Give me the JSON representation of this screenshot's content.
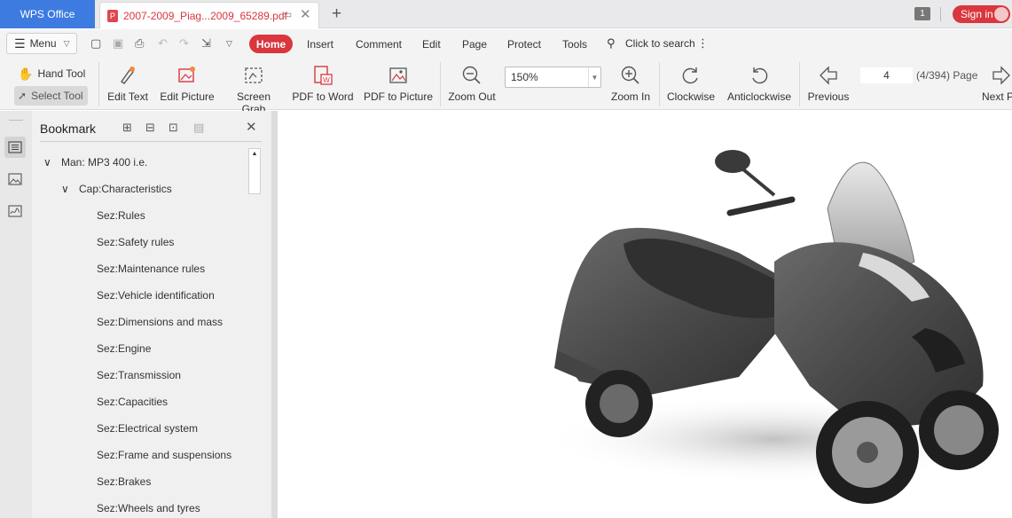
{
  "titlebar": {
    "app_tab": "WPS Office",
    "doc_tab": "2007-2009_Piag...2009_65289.pdf",
    "window_count": "1",
    "signin": "Sign in"
  },
  "menubar": {
    "menu_label": "Menu",
    "tabs": [
      "Home",
      "Insert",
      "Comment",
      "Edit",
      "Page",
      "Protect",
      "Tools"
    ],
    "search": "Click to search"
  },
  "toolbar": {
    "hand_tool": "Hand Tool",
    "select_tool": "Select Tool",
    "edit_text": "Edit Text",
    "edit_picture": "Edit Picture",
    "screen_grab": "Screen Grab",
    "pdf_to_word": "PDF to Word",
    "pdf_to_picture": "PDF to Picture",
    "zoom_out": "Zoom Out",
    "zoom_value": "150%",
    "zoom_in": "Zoom In",
    "clockwise": "Clockwise",
    "anticlockwise": "Anticlockwise",
    "previous": "Previous",
    "page_number": "4",
    "page_count": "(4/394) Page",
    "next_page": "Next Page"
  },
  "bookmark": {
    "title": "Bookmark",
    "items": [
      "Man: MP3 400 i.e.",
      "Cap:Characteristics",
      "Sez:Rules",
      "Sez:Safety rules",
      "Sez:Maintenance rules",
      "Sez:Vehicle identification",
      "Sez:Dimensions and mass",
      "Sez:Engine",
      "Sez:Transmission",
      "Sez:Capacities",
      "Sez:Electrical system",
      "Sez:Frame and suspensions",
      "Sez:Brakes",
      "Sez:Wheels and tyres"
    ]
  },
  "colors": {
    "accent": "#d9363e",
    "wps_blue": "#3d7be0"
  }
}
